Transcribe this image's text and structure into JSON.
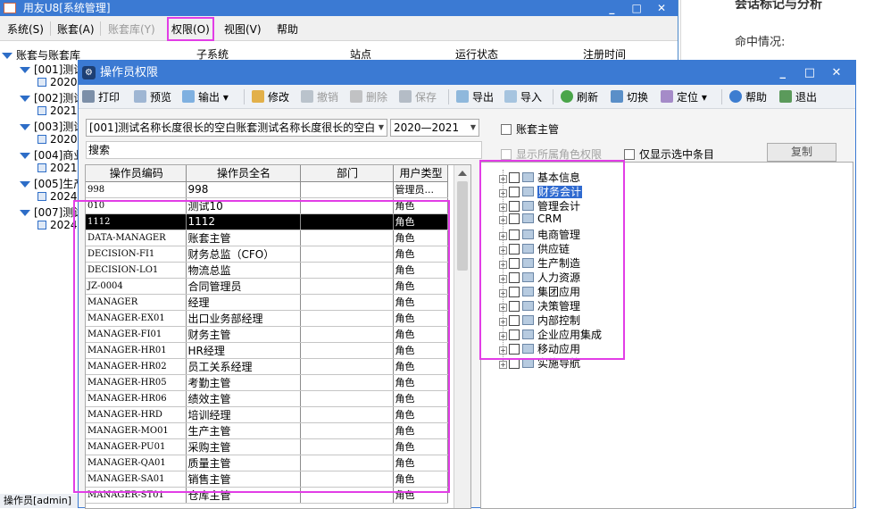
{
  "bg_page": {
    "title_frag": "会话标记与分析",
    "hit_label": "命中情况:"
  },
  "main_window": {
    "title": "用友U8[系统管理]",
    "controls": [
      "_",
      "□",
      "✕"
    ],
    "menu": [
      {
        "label": "系统(S)",
        "enabled": true
      },
      {
        "label": "账套(A)",
        "enabled": true
      },
      {
        "label": "账套库(Y)",
        "enabled": false
      },
      {
        "label": "权限(O)",
        "enabled": true,
        "highlighted": true
      },
      {
        "label": "视图(V)",
        "enabled": true
      },
      {
        "label": "帮助",
        "enabled": true
      }
    ],
    "columns": [
      "子系统",
      "站点",
      "运行状态",
      "注册时间"
    ],
    "tree": {
      "root": "账套与账套库",
      "items": [
        {
          "label": "[001]测试",
          "type": "account"
        },
        {
          "label": "2020-",
          "type": "year"
        },
        {
          "label": "[002]测试",
          "type": "account"
        },
        {
          "label": "2021-",
          "type": "year"
        },
        {
          "label": "[003]测试",
          "type": "account"
        },
        {
          "label": "2020-",
          "type": "year"
        },
        {
          "label": "[004]商业",
          "type": "account"
        },
        {
          "label": "2021-",
          "type": "year"
        },
        {
          "label": "[005]生产",
          "type": "account"
        },
        {
          "label": "2024-",
          "type": "year"
        },
        {
          "label": "[007]测试",
          "type": "account"
        },
        {
          "label": "2024-",
          "type": "year"
        }
      ]
    },
    "status": "操作员[admin]"
  },
  "dialog": {
    "title": "操作员权限",
    "controls": [
      "_",
      "□",
      "✕"
    ],
    "toolbar": [
      {
        "label": "打印",
        "icon": "printer-icon",
        "enabled": true
      },
      {
        "label": "预览",
        "icon": "preview-icon",
        "enabled": true
      },
      {
        "label": "输出",
        "icon": "export-icon",
        "enabled": true,
        "dropdown": true
      },
      {
        "label": "修改",
        "icon": "pencil-icon",
        "enabled": true
      },
      {
        "label": "撤销",
        "icon": "undo-icon",
        "enabled": false
      },
      {
        "label": "删除",
        "icon": "delete-icon",
        "enabled": false
      },
      {
        "label": "保存",
        "icon": "save-icon",
        "enabled": false
      },
      {
        "label": "导出",
        "icon": "export-out-icon",
        "enabled": true
      },
      {
        "label": "导入",
        "icon": "import-icon",
        "enabled": true
      },
      {
        "label": "刷新",
        "icon": "refresh-icon",
        "enabled": true
      },
      {
        "label": "切换",
        "icon": "switch-icon",
        "enabled": true
      },
      {
        "label": "定位",
        "icon": "locate-icon",
        "enabled": true,
        "dropdown": true
      },
      {
        "label": "帮助",
        "icon": "help-icon",
        "enabled": true
      },
      {
        "label": "退出",
        "icon": "exit-icon",
        "enabled": true
      }
    ],
    "account_select": "[001]测试名称长度很长的空白账套测试名称长度很长的空白",
    "year_select": "2020—2021",
    "search_label": "搜索",
    "chk_account_admin": "账套主管",
    "chk_show_role_perm": "显示所属角色权限",
    "chk_show_selected_only": "仅显示选中条目",
    "copy_button": "复制",
    "grid": {
      "columns": [
        "操作员编码",
        "操作员全名",
        "部门",
        "用户类型"
      ],
      "rows": [
        {
          "code": "998",
          "name": "998",
          "dept": "",
          "type": "管理员..."
        },
        {
          "code": "010",
          "name": "测试10",
          "dept": "",
          "type": "角色"
        },
        {
          "code": "1112",
          "name": "1112",
          "dept": "",
          "type": "角色",
          "selected": true
        },
        {
          "code": "DATA-MANAGER",
          "name": "账套主管",
          "dept": "",
          "type": "角色"
        },
        {
          "code": "DECISION-FI1",
          "name": "财务总监（CFO）",
          "dept": "",
          "type": "角色"
        },
        {
          "code": "DECISION-LO1",
          "name": "物流总监",
          "dept": "",
          "type": "角色"
        },
        {
          "code": "JZ-0004",
          "name": "合同管理员",
          "dept": "",
          "type": "角色"
        },
        {
          "code": "MANAGER",
          "name": "经理",
          "dept": "",
          "type": "角色"
        },
        {
          "code": "MANAGER-EX01",
          "name": "出口业务部经理",
          "dept": "",
          "type": "角色"
        },
        {
          "code": "MANAGER-FI01",
          "name": "财务主管",
          "dept": "",
          "type": "角色"
        },
        {
          "code": "MANAGER-HR01",
          "name": "HR经理",
          "dept": "",
          "type": "角色"
        },
        {
          "code": "MANAGER-HR02",
          "name": "员工关系经理",
          "dept": "",
          "type": "角色"
        },
        {
          "code": "MANAGER-HR05",
          "name": "考勤主管",
          "dept": "",
          "type": "角色"
        },
        {
          "code": "MANAGER-HR06",
          "name": "绩效主管",
          "dept": "",
          "type": "角色"
        },
        {
          "code": "MANAGER-HRD",
          "name": "培训经理",
          "dept": "",
          "type": "角色"
        },
        {
          "code": "MANAGER-MO01",
          "name": "生产主管",
          "dept": "",
          "type": "角色"
        },
        {
          "code": "MANAGER-PU01",
          "name": "采购主管",
          "dept": "",
          "type": "角色"
        },
        {
          "code": "MANAGER-QA01",
          "name": "质量主管",
          "dept": "",
          "type": "角色"
        },
        {
          "code": "MANAGER-SA01",
          "name": "销售主管",
          "dept": "",
          "type": "角色"
        },
        {
          "code": "MANAGER-ST01",
          "name": "仓库主管",
          "dept": "",
          "type": "角色"
        }
      ]
    },
    "perm_tree": [
      {
        "label": "基本信息"
      },
      {
        "label": "财务会计",
        "selected": true
      },
      {
        "label": "管理会计"
      },
      {
        "label": "CRM"
      },
      {
        "label": "电商管理"
      },
      {
        "label": "供应链"
      },
      {
        "label": "生产制造"
      },
      {
        "label": "人力资源"
      },
      {
        "label": "集团应用"
      },
      {
        "label": "决策管理"
      },
      {
        "label": "内部控制"
      },
      {
        "label": "企业应用集成"
      },
      {
        "label": "移动应用"
      },
      {
        "label": "实施导航"
      }
    ]
  },
  "colors": {
    "titlebar": "#3b7ad3",
    "highlight_annotation": "#e23de6",
    "tree_selection": "#2f6ad0"
  }
}
